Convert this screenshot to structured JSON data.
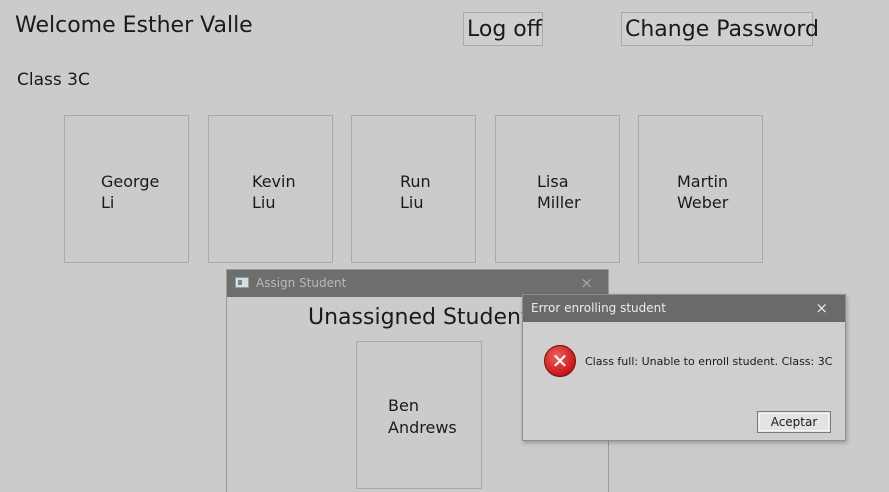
{
  "header": {
    "welcome": "Welcome Esther Valle",
    "logoff_label": "Log off",
    "change_password_label": "Change Password"
  },
  "class_label": "Class 3C",
  "students": [
    {
      "first": "George",
      "last": "Li"
    },
    {
      "first": "Kevin",
      "last": "Liu"
    },
    {
      "first": "Run",
      "last": "Liu"
    },
    {
      "first": "Lisa",
      "last": "Miller"
    },
    {
      "first": "Martin",
      "last": "Weber"
    }
  ],
  "assign_window": {
    "title": "Assign Student",
    "close_glyph": "×",
    "heading": "Unassigned Students",
    "students": [
      {
        "first": "Ben",
        "last": "Andrews"
      }
    ]
  },
  "error_dialog": {
    "title": "Error enrolling student",
    "close_glyph": "×",
    "icon_glyph": "✕",
    "message": "Class full: Unable to enroll student. Class: 3C",
    "ok_label": "Aceptar"
  },
  "colors": {
    "background": "#cbcbcb",
    "titlebar": "#6a6a6a",
    "error_red": "#c81818"
  }
}
